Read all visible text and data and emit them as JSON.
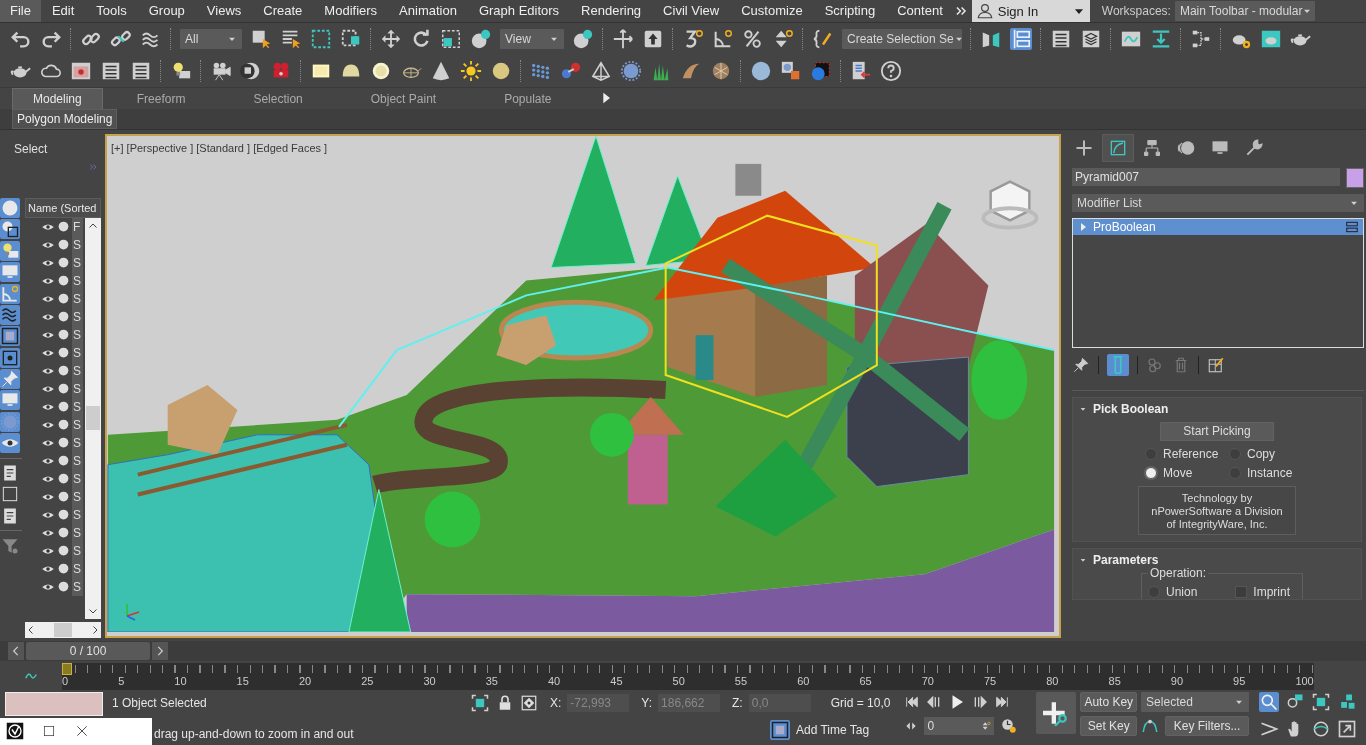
{
  "menu": [
    {
      "label": "File",
      "selected": true
    },
    {
      "label": "Edit",
      "selected": false
    },
    {
      "label": "Tools",
      "selected": false
    },
    {
      "label": "Group",
      "selected": false
    },
    {
      "label": "Views",
      "selected": false
    },
    {
      "label": "Create",
      "selected": false
    },
    {
      "label": "Modifiers",
      "selected": false
    },
    {
      "label": "Animation",
      "selected": false
    },
    {
      "label": "Graph Editors",
      "selected": false
    },
    {
      "label": "Rendering",
      "selected": false
    },
    {
      "label": "Civil View",
      "selected": false
    },
    {
      "label": "Customize",
      "selected": false
    },
    {
      "label": "Scripting",
      "selected": false
    },
    {
      "label": "Content",
      "selected": false
    }
  ],
  "sign_in": "Sign In",
  "workspaces": {
    "label": "Workspaces:",
    "value": "Main Toolbar - modular"
  },
  "toolbar": {
    "selection_filter": "All",
    "reference_coordinates": "View",
    "named_selection": "Create Selection Se"
  },
  "ribbon": {
    "tabs": [
      {
        "label": "Modeling",
        "selected": true
      },
      {
        "label": "Freeform",
        "selected": false
      },
      {
        "label": "Selection",
        "selected": false
      },
      {
        "label": "Object Paint",
        "selected": false
      },
      {
        "label": "Populate",
        "selected": false
      }
    ],
    "panel": "Polygon Modeling"
  },
  "left_panel": {
    "title": "Select",
    "explorer_header": "Name (Sorted",
    "rows": [
      {
        "name": "F"
      },
      {
        "name": "S"
      },
      {
        "name": "S"
      },
      {
        "name": "S"
      },
      {
        "name": "S"
      },
      {
        "name": "S"
      },
      {
        "name": "S"
      },
      {
        "name": "S"
      },
      {
        "name": "S"
      },
      {
        "name": "S"
      },
      {
        "name": "S"
      },
      {
        "name": "S"
      },
      {
        "name": "S"
      },
      {
        "name": "S"
      },
      {
        "name": "S"
      },
      {
        "name": "S"
      },
      {
        "name": "S"
      },
      {
        "name": "S"
      },
      {
        "name": "S"
      },
      {
        "name": "S"
      },
      {
        "name": "S"
      }
    ]
  },
  "viewport": {
    "label": "[+] [Perspective ] [Standard ] [Edged Faces ]"
  },
  "command_panel": {
    "tabs": [
      {
        "selected": false
      },
      {
        "selected": true
      },
      {
        "selected": false
      },
      {
        "selected": false
      },
      {
        "selected": false
      },
      {
        "selected": false
      }
    ],
    "object_name": "Pyramid007",
    "modifier_list": "Modifier List",
    "stack": [
      {
        "label": "ProBoolean",
        "selected": true
      }
    ],
    "pick_boolean": {
      "title": "Pick Boolean",
      "button": "Start Picking",
      "options": [
        {
          "label": "Reference",
          "selected": false
        },
        {
          "label": "Copy",
          "selected": false
        },
        {
          "label": "Move",
          "selected": true
        },
        {
          "label": "Instance",
          "selected": false
        }
      ],
      "credit": [
        "Technology by",
        "nPowerSoftware a Division",
        "of IntegrityWare, Inc."
      ]
    },
    "parameters": {
      "title": "Parameters",
      "group": "Operation:",
      "items": [
        {
          "kind": "radio",
          "label": "Union",
          "selected": false
        },
        {
          "kind": "checkbox",
          "label": "Imprint",
          "checked": false
        }
      ]
    }
  },
  "timeline": {
    "frame": "0 / 100",
    "level": 0,
    "ticks": [
      "0",
      "5",
      "10",
      "15",
      "20",
      "25",
      "30",
      "35",
      "40",
      "45",
      "50",
      "55",
      "60",
      "65",
      "70",
      "75",
      "80",
      "85",
      "90",
      "95",
      "100"
    ]
  },
  "status": {
    "selection": "1 Object Selected",
    "prompt": "drag up-and-down to zoom in and out",
    "coords": [
      {
        "label": "X:",
        "value": "-72,993"
      },
      {
        "label": "Y:",
        "value": "186,662"
      },
      {
        "label": "Z:",
        "value": "0,0"
      }
    ],
    "grid": "Grid = 10,0",
    "time_tag": "Add Time Tag",
    "current_frame": "0",
    "auto_key": "Auto Key",
    "set_key": "Set Key",
    "key_mode": "Selected",
    "key_filters": "Key Filters..."
  }
}
